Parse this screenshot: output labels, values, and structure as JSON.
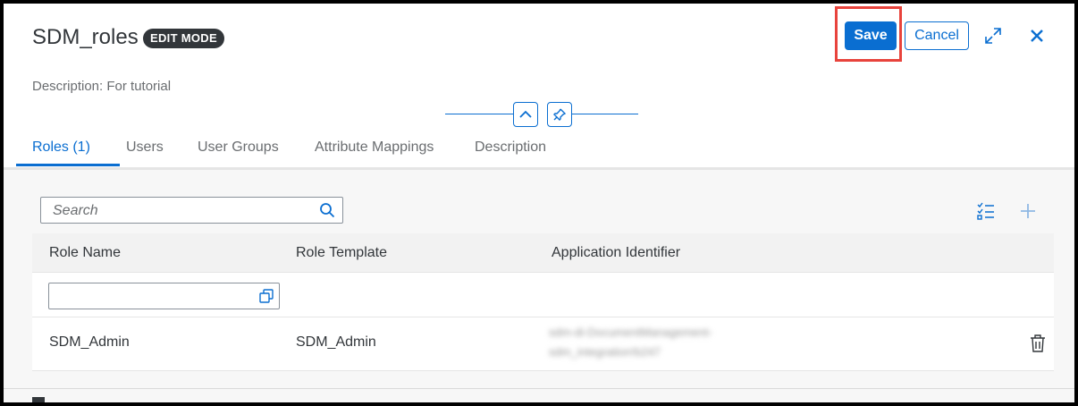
{
  "header": {
    "title": "SDM_roles",
    "mode_badge": "EDIT MODE",
    "description": "Description: For tutorial",
    "save_label": "Save",
    "cancel_label": "Cancel"
  },
  "tabs": [
    {
      "label": "Roles (1)",
      "active": true
    },
    {
      "label": "Users",
      "active": false
    },
    {
      "label": "User Groups",
      "active": false
    },
    {
      "label": "Attribute Mappings",
      "active": false
    },
    {
      "label": "Description",
      "active": false
    }
  ],
  "search": {
    "placeholder": "Search"
  },
  "table": {
    "columns": [
      "Role Name",
      "Role Template",
      "Application Identifier"
    ],
    "rows": [
      {
        "role_name": "SDM_Admin",
        "role_template": "SDM_Admin",
        "application_identifier_line1": "sdm-di-DocumentManagement-",
        "application_identifier_line2": "sdm_integration!b247"
      }
    ]
  },
  "colors": {
    "accent": "#0a6ed1",
    "highlight": "#e8433c"
  }
}
